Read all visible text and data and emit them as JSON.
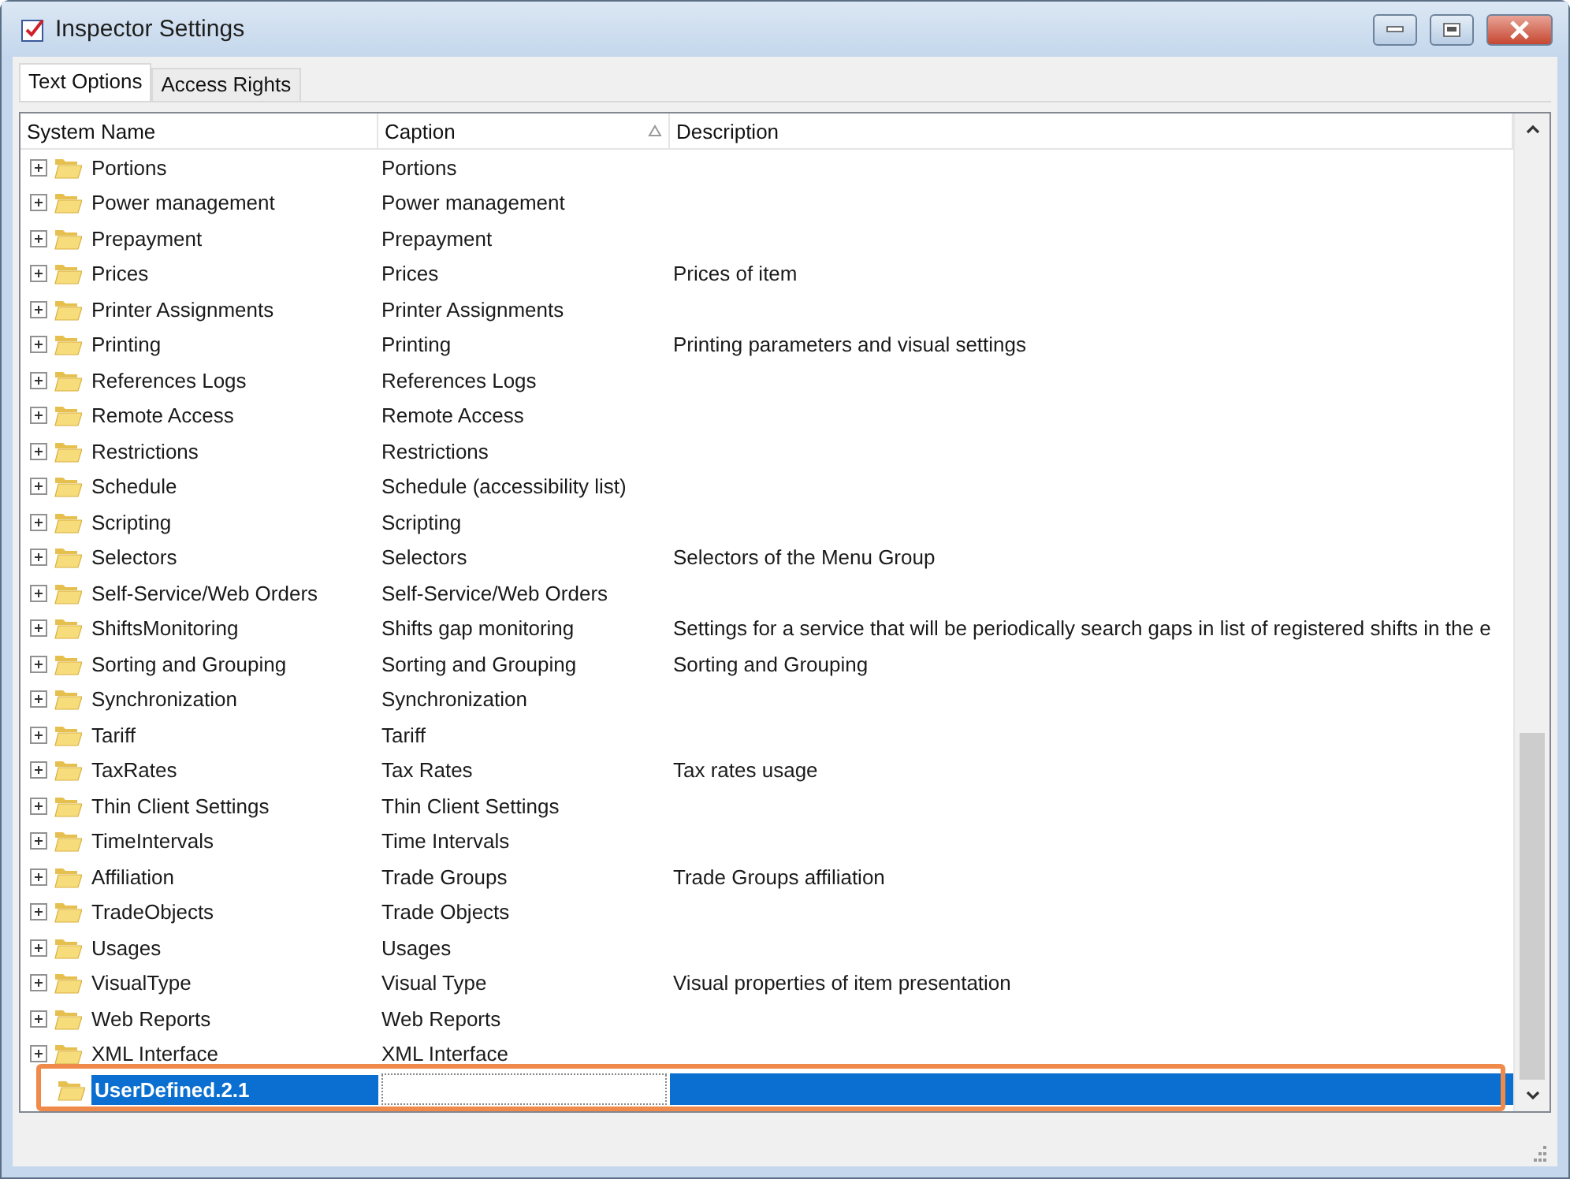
{
  "window": {
    "title": "Inspector Settings"
  },
  "tabs": [
    {
      "label": "Text Options",
      "selected": true
    },
    {
      "label": "Access Rights",
      "selected": false
    }
  ],
  "table": {
    "columns": [
      {
        "label": "System Name",
        "sorted": false
      },
      {
        "label": "Caption",
        "sorted": true
      },
      {
        "label": "Description",
        "sorted": false
      }
    ],
    "rows": [
      {
        "name": "Portions",
        "caption": "Portions",
        "description": "",
        "expandable": true,
        "selected": false
      },
      {
        "name": "Power management",
        "caption": "Power management",
        "description": "",
        "expandable": true,
        "selected": false
      },
      {
        "name": "Prepayment",
        "caption": "Prepayment",
        "description": "",
        "expandable": true,
        "selected": false
      },
      {
        "name": "Prices",
        "caption": "Prices",
        "description": "Prices of item",
        "expandable": true,
        "selected": false
      },
      {
        "name": "Printer Assignments",
        "caption": "Printer Assignments",
        "description": "",
        "expandable": true,
        "selected": false
      },
      {
        "name": "Printing",
        "caption": "Printing",
        "description": "Printing parameters and visual settings",
        "expandable": true,
        "selected": false
      },
      {
        "name": "References Logs",
        "caption": "References Logs",
        "description": "",
        "expandable": true,
        "selected": false
      },
      {
        "name": "Remote Access",
        "caption": "Remote Access",
        "description": "",
        "expandable": true,
        "selected": false
      },
      {
        "name": "Restrictions",
        "caption": "Restrictions",
        "description": "",
        "expandable": true,
        "selected": false
      },
      {
        "name": "Schedule",
        "caption": "Schedule (accessibility list)",
        "description": "",
        "expandable": true,
        "selected": false
      },
      {
        "name": "Scripting",
        "caption": "Scripting",
        "description": "",
        "expandable": true,
        "selected": false
      },
      {
        "name": "Selectors",
        "caption": "Selectors",
        "description": "Selectors of the Menu Group",
        "expandable": true,
        "selected": false
      },
      {
        "name": "Self-Service/Web Orders",
        "caption": "Self-Service/Web Orders",
        "description": "",
        "expandable": true,
        "selected": false
      },
      {
        "name": "ShiftsMonitoring",
        "caption": "Shifts gap monitoring",
        "description": "Settings for a service that will be periodically search gaps in list of registered shifts in the e",
        "expandable": true,
        "selected": false
      },
      {
        "name": "Sorting and Grouping",
        "caption": "Sorting and Grouping",
        "description": "Sorting and Grouping",
        "expandable": true,
        "selected": false
      },
      {
        "name": "Synchronization",
        "caption": "Synchronization",
        "description": "",
        "expandable": true,
        "selected": false
      },
      {
        "name": "Tariff",
        "caption": "Tariff",
        "description": "",
        "expandable": true,
        "selected": false
      },
      {
        "name": "TaxRates",
        "caption": "Tax Rates",
        "description": "Tax rates usage",
        "expandable": true,
        "selected": false
      },
      {
        "name": "Thin Client Settings",
        "caption": "Thin Client Settings",
        "description": "",
        "expandable": true,
        "selected": false
      },
      {
        "name": "TimeIntervals",
        "caption": "Time Intervals",
        "description": "",
        "expandable": true,
        "selected": false
      },
      {
        "name": "Affiliation",
        "caption": "Trade Groups",
        "description": "Trade Groups affiliation",
        "expandable": true,
        "selected": false
      },
      {
        "name": "TradeObjects",
        "caption": "Trade Objects",
        "description": "",
        "expandable": true,
        "selected": false
      },
      {
        "name": "Usages",
        "caption": "Usages",
        "description": "",
        "expandable": true,
        "selected": false
      },
      {
        "name": "VisualType",
        "caption": "Visual Type",
        "description": "Visual properties of item presentation",
        "expandable": true,
        "selected": false
      },
      {
        "name": "Web Reports",
        "caption": "Web Reports",
        "description": "",
        "expandable": true,
        "selected": false
      },
      {
        "name": "XML Interface",
        "caption": "XML Interface",
        "description": "",
        "expandable": true,
        "selected": false
      },
      {
        "name": "UserDefined.2.1",
        "caption": "",
        "description": "",
        "expandable": false,
        "selected": true,
        "editing": true,
        "highlighted": true
      }
    ]
  }
}
